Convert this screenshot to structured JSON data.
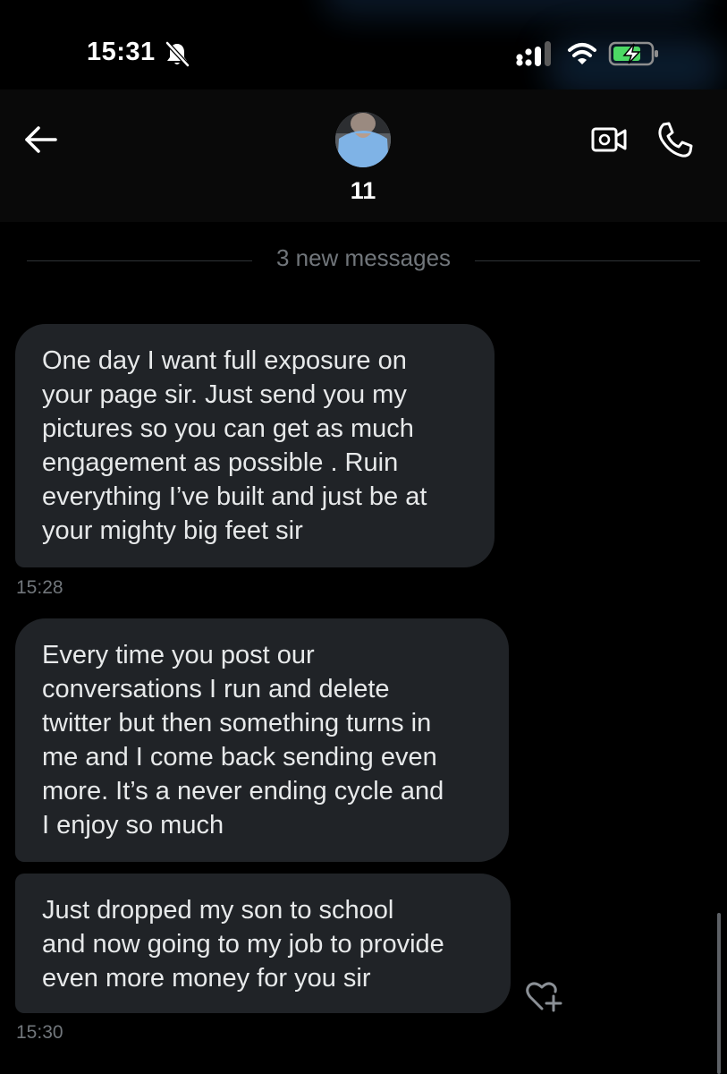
{
  "status_bar": {
    "time": "15:31",
    "icons": [
      "bell-off-icon",
      "signal-icon",
      "wifi-icon",
      "battery-charging-icon"
    ],
    "battery_color": "#4cd964"
  },
  "header": {
    "back_icon": "arrow-left-icon",
    "contact_name": "11",
    "video_icon": "video-camera-icon",
    "phone_icon": "phone-icon"
  },
  "conversation": {
    "new_messages_label": "3 new messages",
    "messages": [
      {
        "lines": [
          "One day I want full exposure on",
          "your page sir. Just send you my",
          "pictures so you can get as much",
          "engagement as possible . Ruin",
          "everything I’ve built and just be at",
          "your mighty big feet sir"
        ],
        "timestamp": "15:28"
      },
      {
        "lines": [
          "Every time you post our",
          "conversations I run and delete",
          "twitter but then something turns in",
          "me and I come back sending even",
          "more. It’s a never ending cycle and",
          "I enjoy so much"
        ]
      },
      {
        "lines": [
          "Just dropped my son to school",
          "and now going to my job to provide",
          "even more money for you sir"
        ],
        "timestamp": "15:30",
        "reaction_icon": "heart-plus-icon"
      }
    ]
  },
  "colors": {
    "background": "#000000",
    "bubble": "#202327",
    "header": "#090909",
    "muted_text": "#71767b"
  }
}
